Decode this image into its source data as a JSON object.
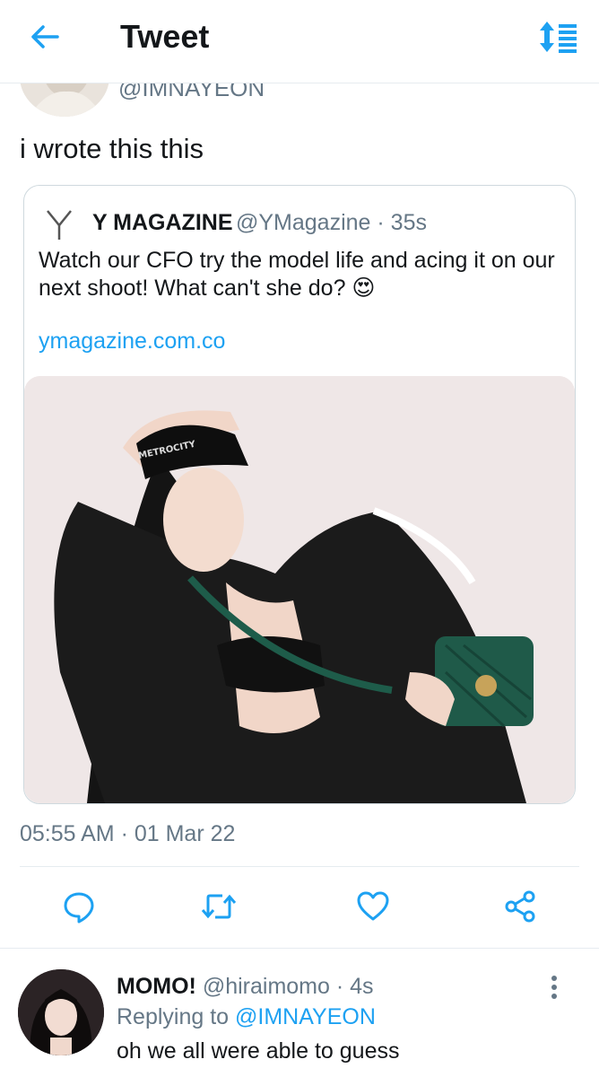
{
  "header": {
    "title": "Tweet",
    "back_icon": "back-arrow-icon",
    "sort_icon": "sort-icon"
  },
  "tweet": {
    "handle": "@IMNAYEON",
    "text": "i wrote this this",
    "timestamp": "05:55 AM · 01 Mar 22"
  },
  "quoted": {
    "name": "Y MAGAZINE",
    "handle_time": "@YMagazine · 35s",
    "text": "Watch our CFO try the model life and acing it on our next shoot! What can't she do? 😍",
    "link": "ymagazine.com.co",
    "media_caption": "METROCITY"
  },
  "actions": [
    {
      "name": "reply",
      "icon": "reply-icon"
    },
    {
      "name": "retweet",
      "icon": "retweet-icon"
    },
    {
      "name": "like",
      "icon": "heart-icon"
    },
    {
      "name": "share",
      "icon": "share-icon"
    }
  ],
  "reply": {
    "name": "MOMO!",
    "handle_time": "@hiraimomo · 4s",
    "replying_label": "Replying to",
    "replying_to": "@IMNAYEON",
    "text": "oh we all were able to guess"
  },
  "colors": {
    "accent": "#1da1f2",
    "secondary_text": "#657786",
    "primary_text": "#14171a",
    "border": "#cfd9de"
  }
}
